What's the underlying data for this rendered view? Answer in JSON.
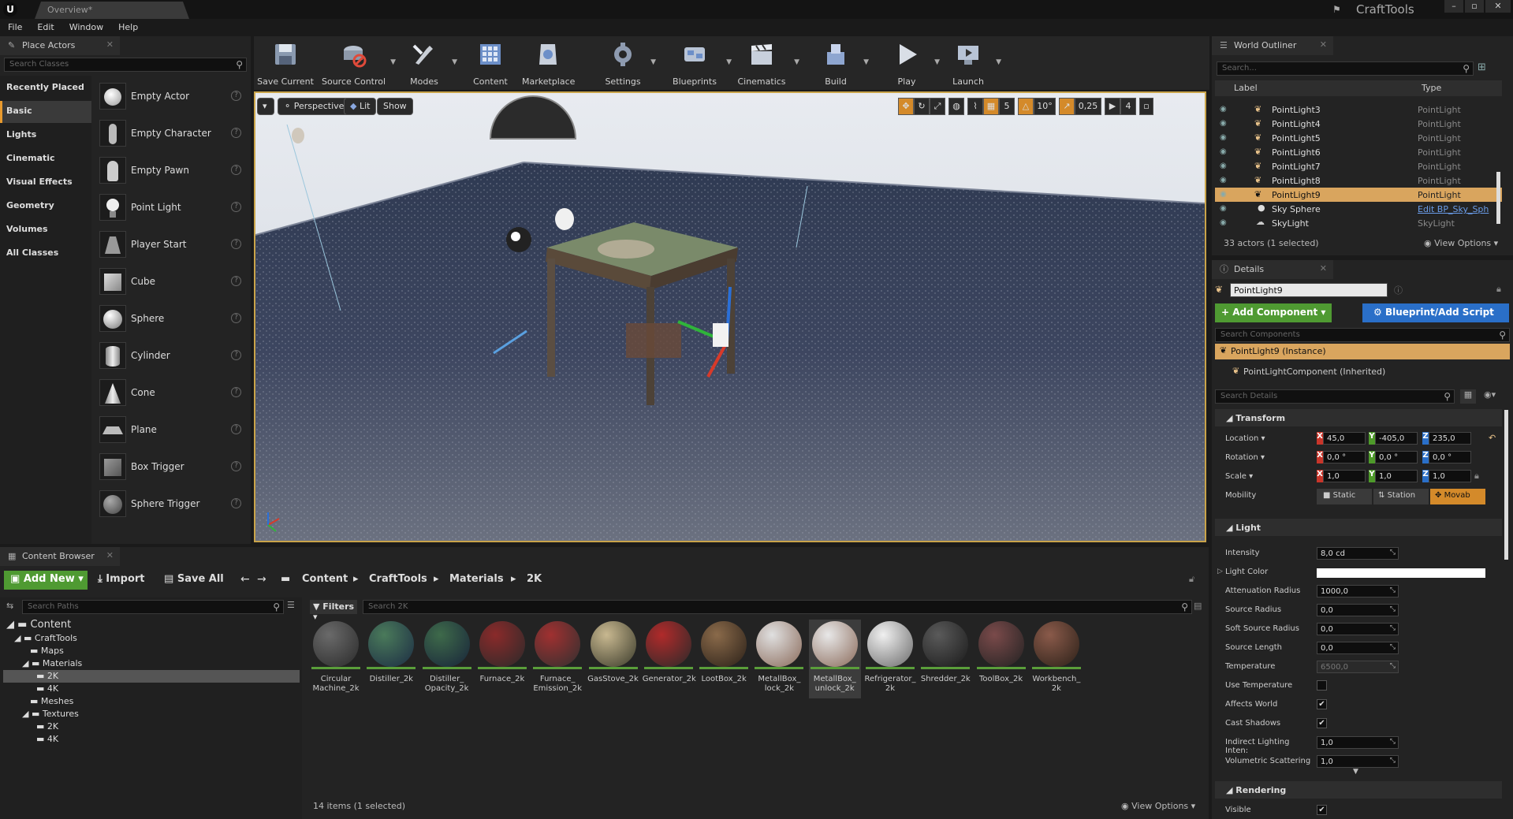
{
  "titlebar": {
    "tab": "Overview*",
    "app": "CraftTools",
    "logo": "U"
  },
  "menu": [
    "File",
    "Edit",
    "Window",
    "Help"
  ],
  "place_actors": {
    "title": "Place Actors",
    "search_placeholder": "Search Classes",
    "categories": [
      "Recently Placed",
      "Basic",
      "Lights",
      "Cinematic",
      "Visual Effects",
      "Geometry",
      "Volumes",
      "All Classes"
    ],
    "selected_category": "Basic",
    "actors": [
      "Empty Actor",
      "Empty Character",
      "Empty Pawn",
      "Point Light",
      "Player Start",
      "Cube",
      "Sphere",
      "Cylinder",
      "Cone",
      "Plane",
      "Box Trigger",
      "Sphere Trigger"
    ]
  },
  "toolbar": [
    "Save Current",
    "Source Control",
    "Modes",
    "Content",
    "Marketplace",
    "Settings",
    "Blueprints",
    "Cinematics",
    "Build",
    "Play",
    "Launch"
  ],
  "viewport": {
    "perspective": "Perspective",
    "lit": "Lit",
    "show": "Show",
    "grid_snap": "5",
    "rotation_snap": "10°",
    "scale_snap": "0,25",
    "camera_speed": "4"
  },
  "outliner": {
    "title": "World Outliner",
    "search_placeholder": "Search...",
    "col_label": "Label",
    "col_type": "Type",
    "rows": [
      {
        "name": "PointLight3",
        "type": "PointLight"
      },
      {
        "name": "PointLight4",
        "type": "PointLight"
      },
      {
        "name": "PointLight5",
        "type": "PointLight"
      },
      {
        "name": "PointLight6",
        "type": "PointLight"
      },
      {
        "name": "PointLight7",
        "type": "PointLight"
      },
      {
        "name": "PointLight8",
        "type": "PointLight"
      },
      {
        "name": "PointLight9",
        "type": "PointLight"
      },
      {
        "name": "Sky Sphere",
        "type": "Edit BP_Sky_Sph"
      },
      {
        "name": "SkyLight",
        "type": "SkyLight"
      }
    ],
    "selected": "PointLight9",
    "count": "33 actors (1 selected)",
    "view_options": "View Options"
  },
  "details": {
    "title": "Details",
    "actor_name": "PointLight9",
    "add_component": "Add Component",
    "blueprint": "Blueprint/Add Script",
    "search_components": "Search Components",
    "instance": "PointLight9 (Instance)",
    "component": "PointLightComponent (Inherited)",
    "search_details": "Search Details",
    "transform_title": "Transform",
    "location_label": "Location",
    "rotation_label": "Rotation",
    "scale_label": "Scale",
    "mobility_label": "Mobility",
    "location": {
      "x": "45,0",
      "y": "-405,0",
      "z": "235,0"
    },
    "rotation": {
      "x": "0,0 °",
      "y": "0,0 °",
      "z": "0,0 °"
    },
    "scale": {
      "x": "1,0",
      "y": "1,0",
      "z": "1,0"
    },
    "mobility": [
      "Static",
      "Station",
      "Movab"
    ],
    "light_title": "Light",
    "light_props": [
      {
        "label": "Intensity",
        "value": "8,0 cd"
      },
      {
        "label": "Light Color",
        "value": ""
      },
      {
        "label": "Attenuation Radius",
        "value": "1000,0"
      },
      {
        "label": "Source Radius",
        "value": "0,0"
      },
      {
        "label": "Soft Source Radius",
        "value": "0,0"
      },
      {
        "label": "Source Length",
        "value": "0,0"
      },
      {
        "label": "Temperature",
        "value": "6500,0"
      },
      {
        "label": "Use Temperature",
        "value": ""
      },
      {
        "label": "Affects World",
        "value": "✔"
      },
      {
        "label": "Cast Shadows",
        "value": "✔"
      },
      {
        "label": "Indirect Lighting Inten:",
        "value": "1,0"
      },
      {
        "label": "Volumetric Scattering",
        "value": "1,0"
      }
    ],
    "rendering_title": "Rendering",
    "visible_label": "Visible",
    "visible_value": "✔"
  },
  "content_browser": {
    "title": "Content Browser",
    "add_new": "Add New",
    "import": "Import",
    "save_all": "Save All",
    "breadcrumb": [
      "Content",
      "CraftTools",
      "Materials",
      "2K"
    ],
    "search_paths": "Search Paths",
    "filters": "Filters",
    "search_placeholder": "Search 2K",
    "tree": [
      "Content",
      "CraftTools",
      "Maps",
      "Materials",
      "2K",
      "4K",
      "Meshes",
      "Textures",
      "2K",
      "4K"
    ],
    "assets": [
      "Circular Machine_2k",
      "Distiller_2k",
      "Distiller_ Opacity_2k",
      "Furnace_2k",
      "Furnace_ Emission_2k",
      "GasStove_2k",
      "Generator_2k",
      "LootBox_2k",
      "MetallBox_ lock_2k",
      "MetallBox_ unlock_2k",
      "Refrigerator_ 2k",
      "Shredder_2k",
      "ToolBox_2k",
      "Workbench_ 2k"
    ],
    "selected_asset": "MetallBox_ unlock_2k",
    "count": "14 items (1 selected)",
    "view_options": "View Options"
  },
  "colors": {
    "accent": "#e89a2e",
    "selection": "#d9a55e",
    "green": "#5a9e3a",
    "blue": "#2a6fc8"
  }
}
